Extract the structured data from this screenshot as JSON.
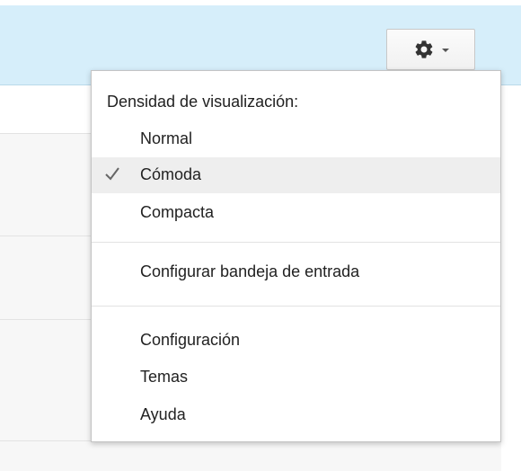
{
  "toolbar": {
    "settings_icon": "gear-icon",
    "dropdown_icon": "caret-down-icon"
  },
  "menu": {
    "header": "Densidad de visualización:",
    "density_options": [
      {
        "label": "Normal",
        "selected": false
      },
      {
        "label": "Cómoda",
        "selected": true
      },
      {
        "label": "Compacta",
        "selected": false
      }
    ],
    "configure_inbox": "Configurar bandeja de entrada",
    "settings": "Configuración",
    "themes": "Temas",
    "help": "Ayuda"
  },
  "colors": {
    "topbar_bg": "#d6eefa",
    "selected_bg": "#eeeeee",
    "panel_bg": "#f7f7f7"
  }
}
